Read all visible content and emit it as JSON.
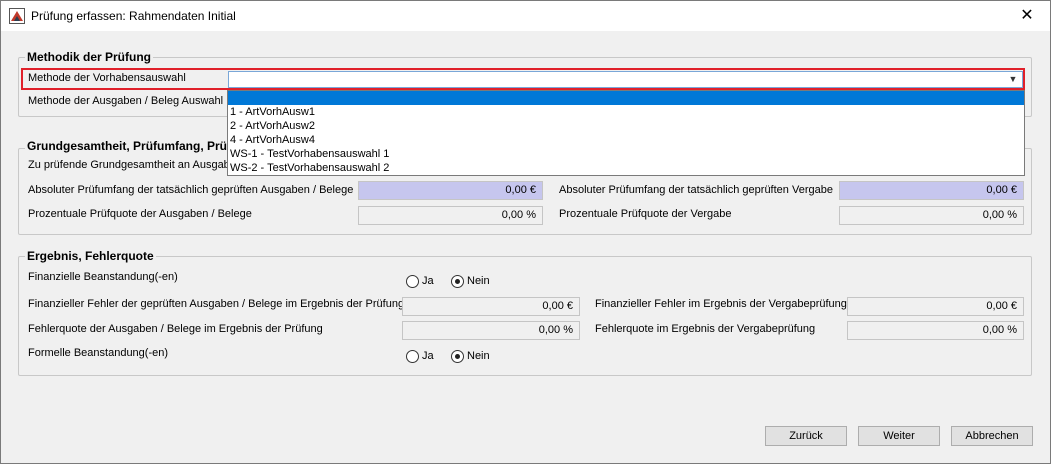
{
  "window": {
    "title": "Prüfung erfassen: Rahmendaten Initial",
    "close_symbol": "✕"
  },
  "methodik": {
    "title": "Methodik der Prüfung",
    "vorhaben_label": "Methode der Vorhabensauswahl",
    "vorhaben_value": "",
    "ausgaben_label": "Methode der Ausgaben / Beleg Auswahl",
    "dropdown_options": [
      "",
      "1 - ArtVorhAusw1",
      "2 - ArtVorhAusw2",
      "4 - ArtVorhAusw4",
      "WS-1 - TestVorhabensauswahl 1",
      "WS-2 - TestVorhabensauswahl 2"
    ]
  },
  "grund": {
    "title": "Grundgesamtheit, Prüfumfang, Prüf",
    "gg_label": "Zu prüfende Grundgesamtheit an Ausgab",
    "abs_ausgaben_label": "Absoluter Prüfumfang der tatsächlich geprüften Ausgaben / Belege",
    "abs_ausgaben_value": "0,00 €",
    "abs_vergabe_label": "Absoluter Prüfumfang der tatsächlich geprüften Vergabe",
    "abs_vergabe_value": "0,00 €",
    "proz_ausgaben_label": "Prozentuale Prüfquote der Ausgaben / Belege",
    "proz_ausgaben_value": "0,00 %",
    "proz_vergabe_label": "Prozentuale Prüfquote der Vergabe",
    "proz_vergabe_value": "0,00 %"
  },
  "ergebnis": {
    "title": "Ergebnis, Fehlerquote",
    "fin_label": "Finanzielle Beanstandung(-en)",
    "ja": "Ja",
    "nein": "Nein",
    "fin_fehler_label": "Finanzieller Fehler der geprüften Ausgaben / Belege im Ergebnis der Prüfung",
    "fin_fehler_value": "0,00 €",
    "fin_fehler_vergabe_label": "Finanzieller Fehler im Ergebnis der Vergabeprüfung",
    "fin_fehler_vergabe_value": "0,00 €",
    "quote_label": "Fehlerquote der Ausgaben / Belege im Ergebnis der Prüfung",
    "quote_value": "0,00 %",
    "quote_vergabe_label": "Fehlerquote im Ergebnis der Vergabeprüfung",
    "quote_vergabe_value": "0,00 %",
    "formell_label": "Formelle Beanstandung(-en)",
    "fin_selected": "Nein",
    "formell_selected": "Nein"
  },
  "buttons": {
    "back": "Zurück",
    "next": "Weiter",
    "cancel": "Abbrechen"
  },
  "colors": {
    "highlight": "#e0202a",
    "selection": "#0078d7",
    "computed_field": "#c6c6ee"
  }
}
